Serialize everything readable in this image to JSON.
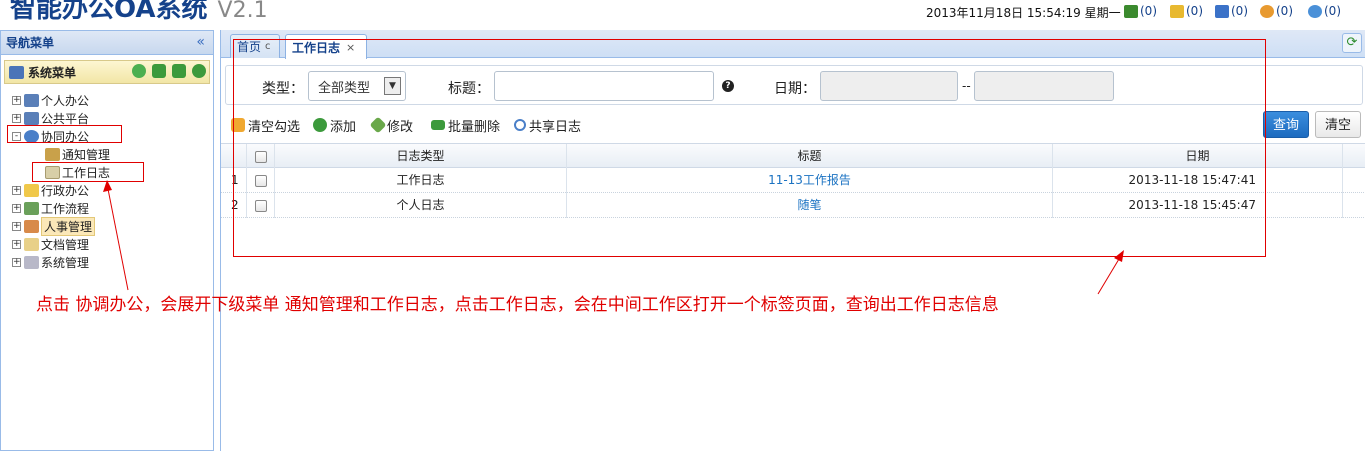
{
  "header": {
    "app_title": "智能办公OA系统",
    "version": "V2.1",
    "datetime": "2013年11月18日 15:54:19 星期一",
    "indicators": [
      {
        "icon": "org-chart-icon",
        "count": "(0)",
        "color": "#3b8a2e"
      },
      {
        "icon": "mail-icon",
        "count": "(0)",
        "color": "#e8b930"
      },
      {
        "icon": "calendar-icon",
        "count": "(0)",
        "color": "#3b72c8"
      },
      {
        "icon": "chat-icon",
        "count": "(0)",
        "color": "#e89a30"
      },
      {
        "icon": "message-icon",
        "count": "(0)",
        "color": "#4a90d8"
      }
    ]
  },
  "nav": {
    "title": "导航菜单",
    "collapse_icon": "«",
    "system_menu": "系统菜单",
    "items": [
      {
        "label": "个人办公",
        "toggle": "+",
        "icon": "computer-icon",
        "level": 0
      },
      {
        "label": "公共平台",
        "toggle": "+",
        "icon": "computer-icon",
        "level": 0
      },
      {
        "label": "协同办公",
        "toggle": "-",
        "icon": "users-icon",
        "level": 0
      },
      {
        "label": "通知管理",
        "toggle": "",
        "icon": "megaphone-icon",
        "level": 1
      },
      {
        "label": "工作日志",
        "toggle": "",
        "icon": "book-icon",
        "level": 1
      },
      {
        "label": "行政办公",
        "toggle": "+",
        "icon": "folder-icon",
        "level": 0
      },
      {
        "label": "工作流程",
        "toggle": "+",
        "icon": "flow-icon",
        "level": 0
      },
      {
        "label": "人事管理",
        "toggle": "+",
        "icon": "person-icon",
        "level": 0
      },
      {
        "label": "文档管理",
        "toggle": "+",
        "icon": "document-icon",
        "level": 0
      },
      {
        "label": "系统管理",
        "toggle": "+",
        "icon": "settings-icon",
        "level": 0
      }
    ]
  },
  "tabs": [
    {
      "label": "首页",
      "suffix": "c"
    },
    {
      "label": "工作日志",
      "suffix": "×"
    }
  ],
  "search": {
    "type_label": "类型：",
    "type_value": "全部类型",
    "title_label": "标题：",
    "title_value": "",
    "date_label": "日期：",
    "date_sep": "--"
  },
  "toolbar": {
    "clear_selection": "清空勾选",
    "add": "添加",
    "edit": "修改",
    "batch_delete": "批量删除",
    "share": "共享日志",
    "query": "查询",
    "clear": "清空"
  },
  "grid": {
    "columns": [
      "日志类型",
      "标题",
      "日期"
    ],
    "rows": [
      {
        "num": "1",
        "type": "工作日志",
        "title": "11-13工作报告",
        "date": "2013-11-18 15:47:41"
      },
      {
        "num": "2",
        "type": "个人日志",
        "title": "随笔",
        "date": "2013-11-18 15:45:47"
      }
    ]
  },
  "annotation": {
    "note": "点击  协调办公，会展开下级菜单 通知管理和工作日志，点击工作日志，会在中间工作区打开一个标签页面，查询出工作日志信息",
    "color": "#e00000"
  }
}
